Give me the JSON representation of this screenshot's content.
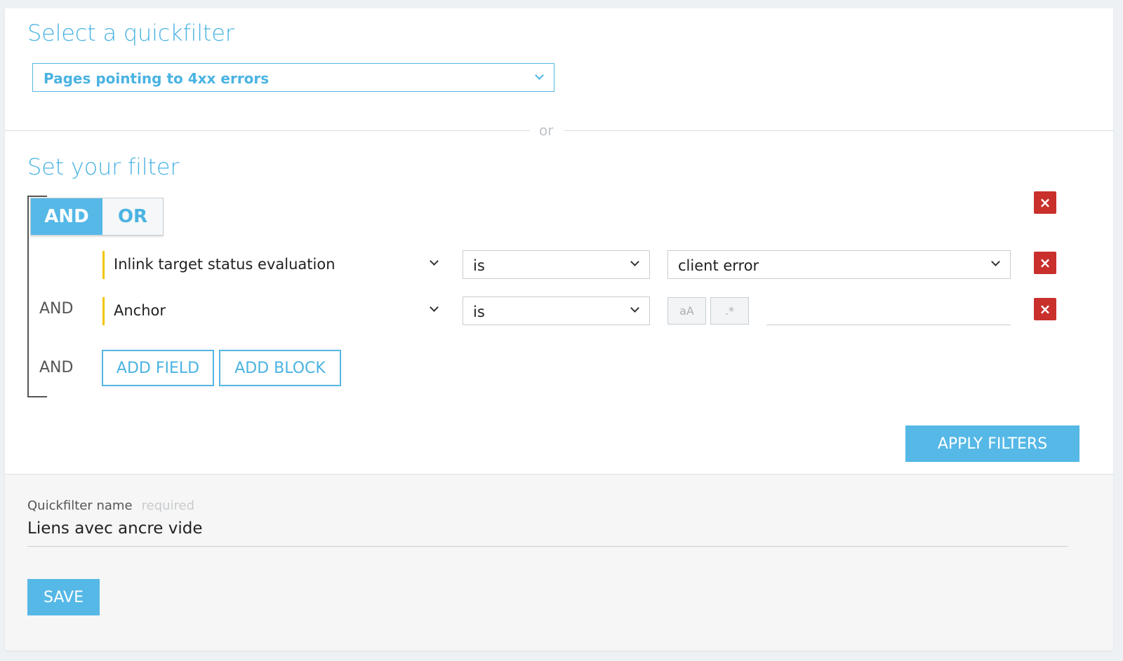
{
  "quickfilter": {
    "title": "Select a quickfilter",
    "selected": "Pages pointing to 4xx errors",
    "or_separator": "or"
  },
  "filter": {
    "title": "Set your filter",
    "toggle": {
      "and_label": "AND",
      "or_label": "OR",
      "active": "AND"
    },
    "rows": [
      {
        "connector": "",
        "field": "Inlink target status evaluation",
        "operator": "is",
        "value": "client error",
        "value_type": "select"
      },
      {
        "connector": "AND",
        "field": "Anchor",
        "operator": "is",
        "value": "",
        "value_type": "text",
        "case_button": "aA",
        "regex_button": ".*"
      }
    ],
    "actions_connector": "AND",
    "add_field_label": "ADD FIELD",
    "add_block_label": "ADD BLOCK",
    "apply_label": "APPLY FILTERS",
    "remove_symbol": "×"
  },
  "save_section": {
    "name_label": "Quickfilter name",
    "required_label": "required",
    "name_value": "Liens avec ancre vide",
    "save_label": "SAVE"
  },
  "colors": {
    "accent": "#4ab3e2",
    "remove": "#c9302c",
    "field_marker": "#f2c500"
  }
}
